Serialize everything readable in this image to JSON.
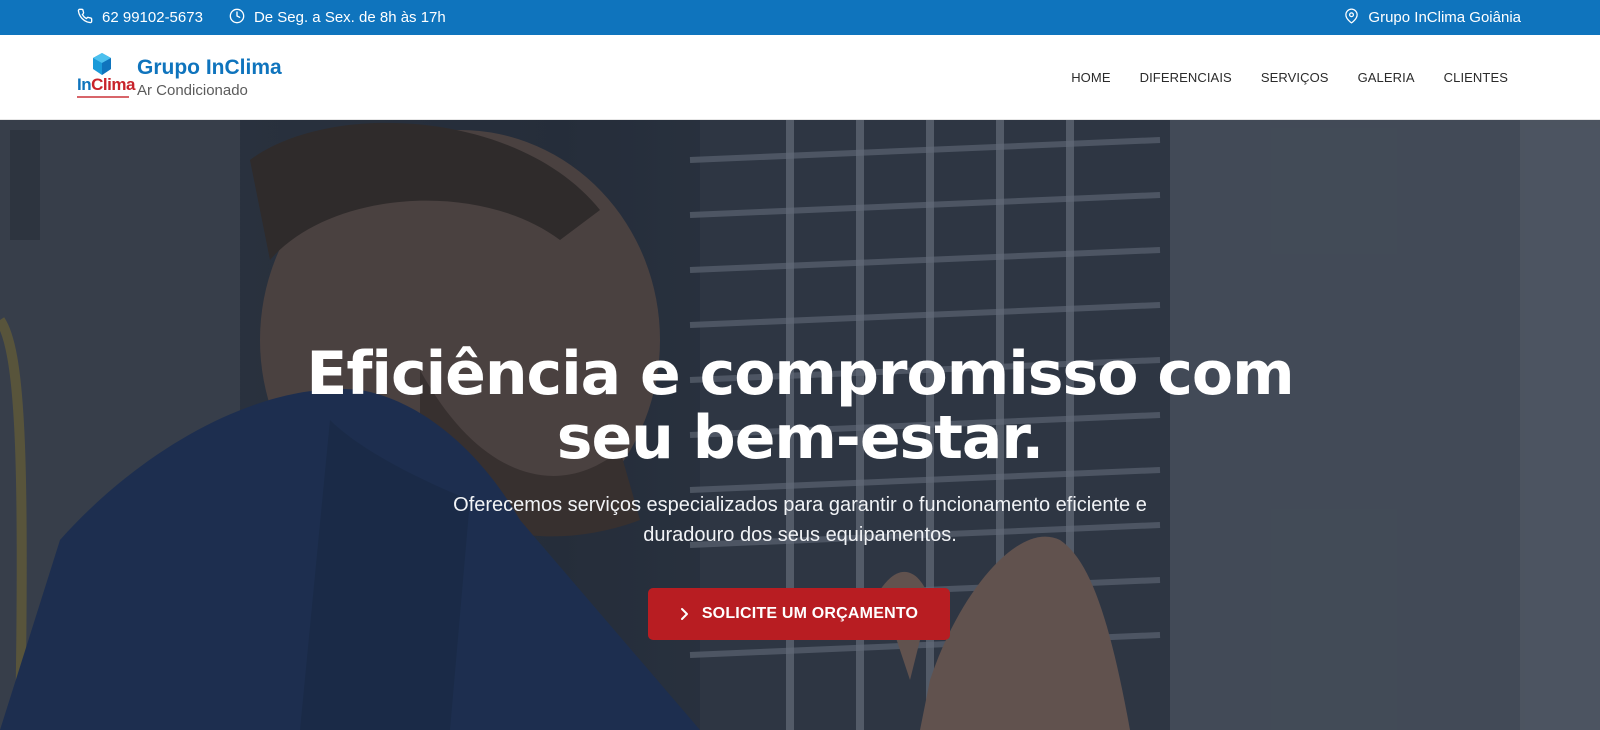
{
  "topbar": {
    "phone": "62 99102-5673",
    "hours": "De Seg. a Sex. de 8h às 17h",
    "location": "Grupo InClima Goiânia",
    "background": "#0f74bd"
  },
  "brand": {
    "logo_in": "In",
    "logo_clima": "Clima",
    "title": "Grupo InClima",
    "subtitle": "Ar Condicionado"
  },
  "nav": {
    "items": [
      "HOME",
      "DIFERENCIAIS",
      "SERVIÇOS",
      "GALERIA",
      "CLIENTES"
    ]
  },
  "hero": {
    "title": "Eficiência e compromisso com seu bem-estar.",
    "description": "Oferecemos serviços especializados para garantir o funcionamento eficiente e duradouro dos seus equipamentos.",
    "cta_label": "SOLICITE UM ORÇAMENTO",
    "cta_color": "#b81d22"
  },
  "icons": {
    "phone": "phone-icon",
    "clock": "clock-icon",
    "location": "map-pin-icon",
    "cta": "chevron-right-icon"
  }
}
